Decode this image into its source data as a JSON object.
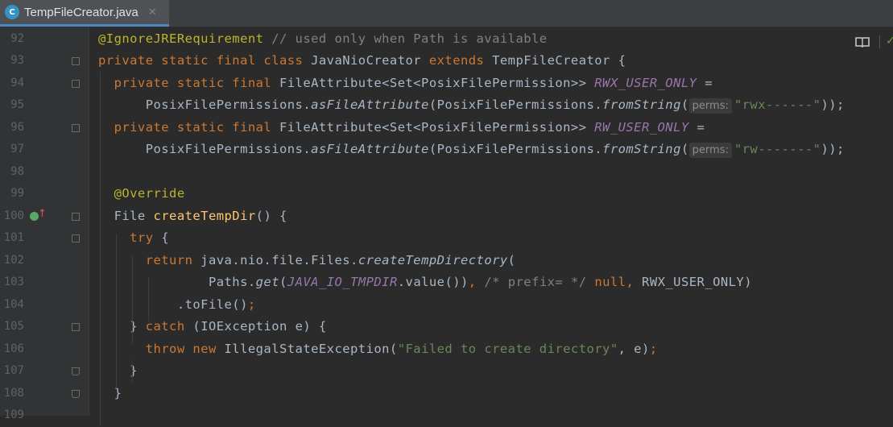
{
  "tab": {
    "title": "TempFileCreator.java",
    "icon": "C",
    "close": "✕"
  },
  "lines": [
    {
      "num": "92",
      "segs": [
        [
          "@IgnoreJRERequirement",
          "an"
        ],
        [
          " // used only when Path is available",
          "cm"
        ]
      ]
    },
    {
      "num": "93",
      "segs": [
        [
          "private static final class ",
          "kw"
        ],
        [
          "JavaNioCreator ",
          ""
        ],
        [
          "extends ",
          "kw"
        ],
        [
          "TempFileCreator {",
          ""
        ]
      ]
    },
    {
      "num": "94",
      "segs": [
        [
          "  private static final ",
          "kw"
        ],
        [
          "FileAttribute<Set<PosixFilePermission>> ",
          ""
        ],
        [
          "RWX_USER_ONLY",
          "cs"
        ],
        [
          " =",
          ""
        ]
      ]
    },
    {
      "num": "95",
      "segs": [
        [
          "      PosixFilePermissions.",
          ""
        ],
        [
          "asFileAttribute",
          "it"
        ],
        [
          "(PosixFilePermissions.",
          ""
        ],
        [
          "fromString",
          "it"
        ],
        [
          "(",
          ""
        ],
        [
          "perms:",
          "hint"
        ],
        [
          "\"rwx------\"",
          "str"
        ],
        [
          "));",
          ""
        ]
      ]
    },
    {
      "num": "96",
      "segs": [
        [
          "  private static final ",
          "kw"
        ],
        [
          "FileAttribute<Set<PosixFilePermission>> ",
          ""
        ],
        [
          "RW_USER_ONLY",
          "cs"
        ],
        [
          " =",
          ""
        ]
      ]
    },
    {
      "num": "97",
      "segs": [
        [
          "      PosixFilePermissions.",
          ""
        ],
        [
          "asFileAttribute",
          "it"
        ],
        [
          "(PosixFilePermissions.",
          ""
        ],
        [
          "fromString",
          "it"
        ],
        [
          "(",
          ""
        ],
        [
          "perms:",
          "hint"
        ],
        [
          "\"rw-------\"",
          "str"
        ],
        [
          "));",
          ""
        ]
      ]
    },
    {
      "num": "98",
      "segs": []
    },
    {
      "num": "99",
      "segs": [
        [
          "  @Override",
          "an"
        ]
      ]
    },
    {
      "num": "100",
      "segs": [
        [
          "  File ",
          ""
        ],
        [
          "createTempDir",
          "fn"
        ],
        [
          "() {",
          ""
        ]
      ]
    },
    {
      "num": "101",
      "segs": [
        [
          "    try ",
          "kw"
        ],
        [
          "{",
          ""
        ]
      ]
    },
    {
      "num": "102",
      "segs": [
        [
          "      return ",
          "kw"
        ],
        [
          "java.nio.file.Files.",
          ""
        ],
        [
          "createTempDirectory",
          "it"
        ],
        [
          "(",
          ""
        ]
      ]
    },
    {
      "num": "103",
      "segs": [
        [
          "              Paths.",
          ""
        ],
        [
          "get",
          "it"
        ],
        [
          "(",
          ""
        ],
        [
          "JAVA_IO_TMPDIR",
          "cs"
        ],
        [
          ".value())",
          ""
        ],
        [
          ", ",
          "kw"
        ],
        [
          "/* prefix= */ ",
          "cm"
        ],
        [
          "null",
          "kw"
        ],
        [
          ", ",
          "kw"
        ],
        [
          "RWX_USER_ONLY",
          ""
        ],
        [
          ")",
          ""
        ]
      ]
    },
    {
      "num": "104",
      "segs": [
        [
          "          .toFile()",
          ""
        ],
        [
          ";",
          "kw"
        ]
      ]
    },
    {
      "num": "105",
      "segs": [
        [
          "    } ",
          ""
        ],
        [
          "catch ",
          "kw"
        ],
        [
          "(IOException e) {",
          ""
        ]
      ]
    },
    {
      "num": "106",
      "segs": [
        [
          "      throw new ",
          "kw"
        ],
        [
          "IllegalStateException(",
          ""
        ],
        [
          "\"Failed to create directory\"",
          "str"
        ],
        [
          ", e)",
          ""
        ],
        [
          ";",
          "kw"
        ]
      ]
    },
    {
      "num": "107",
      "segs": [
        [
          "    }",
          ""
        ]
      ]
    },
    {
      "num": "108",
      "segs": [
        [
          "  }",
          ""
        ]
      ]
    },
    {
      "num": "109",
      "segs": []
    }
  ],
  "folds": {
    "93": "start",
    "94": "start",
    "96": "start",
    "100": "start",
    "101": "start",
    "105": "start",
    "107": "end",
    "108": "end"
  },
  "colors": {
    "background": "#2b2b2b",
    "keyword": "#cc7832",
    "annotation": "#bbb529",
    "constant": "#9876aa",
    "string": "#6a8759",
    "method": "#ffc66d",
    "comment": "#808080"
  },
  "toolbar": {
    "reader_mode_icon": "book-icon",
    "inspection_icon": "check-icon"
  }
}
